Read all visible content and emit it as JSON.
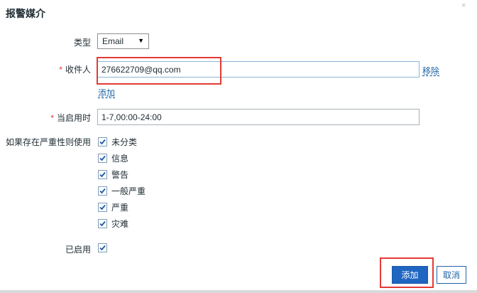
{
  "dialog": {
    "title": "报警媒介",
    "close_glyph": "×"
  },
  "form": {
    "type": {
      "label": "类型",
      "value": "Email"
    },
    "recipient": {
      "required_mark": "*",
      "label": "收件人",
      "value": "276622709@qq.com",
      "remove_link": "移除",
      "add_link": "添加"
    },
    "active_period": {
      "required_mark": "*",
      "label": "当启用时",
      "value": "1-7,00:00-24:00"
    },
    "severity": {
      "label": "如果存在严重性则使用",
      "options": [
        {
          "label": "未分类",
          "checked": true
        },
        {
          "label": "信息",
          "checked": true
        },
        {
          "label": "警告",
          "checked": true
        },
        {
          "label": "一般严重",
          "checked": true
        },
        {
          "label": "严重",
          "checked": true
        },
        {
          "label": "灾难",
          "checked": true
        }
      ]
    },
    "enabled": {
      "label": "已启用",
      "checked": true
    }
  },
  "footer": {
    "add_button": "添加",
    "cancel_button": "取消"
  },
  "colors": {
    "primary": "#1f65c2",
    "link": "#1f65a6",
    "required": "#e33734",
    "highlight": "#e43a35"
  }
}
